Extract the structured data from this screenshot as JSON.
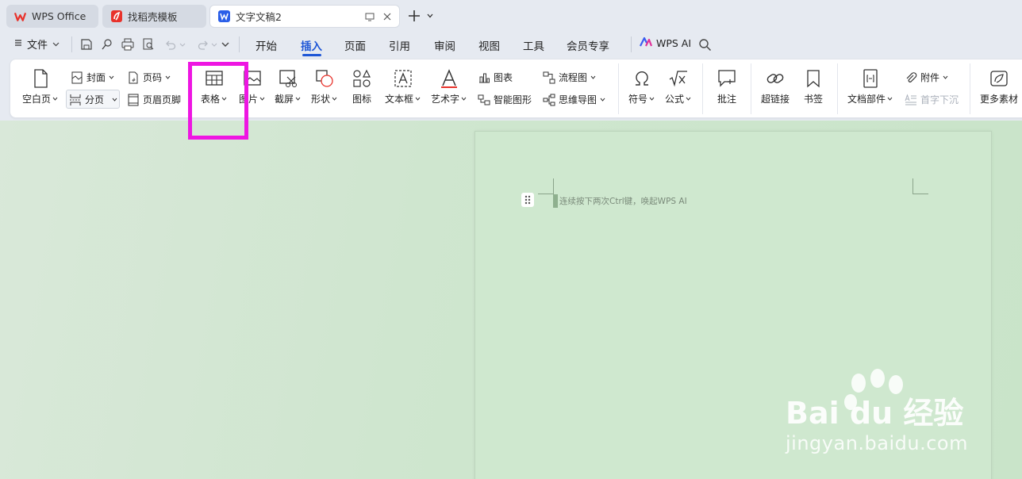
{
  "tabs": [
    {
      "label": "WPS Office",
      "icon": "wps-logo-icon",
      "active": false
    },
    {
      "label": "找稻壳模板",
      "icon": "docer-template-icon",
      "active": false
    },
    {
      "label": "文字文稿2",
      "icon": "word-doc-icon",
      "active": true
    }
  ],
  "menu": {
    "file_label": "文件",
    "tabs": [
      "开始",
      "插入",
      "页面",
      "引用",
      "审阅",
      "视图",
      "工具",
      "会员专享"
    ],
    "active_tab": "插入",
    "wps_ai_label": "WPS AI"
  },
  "ribbon": {
    "blank_page": "空白页",
    "cover": "封面",
    "page_break": "分页",
    "page_number": "页码",
    "header_footer": "页眉页脚",
    "table": "表格",
    "picture": "图片",
    "screenshot": "截屏",
    "shape": "形状",
    "icon": "图标",
    "textbox": "文本框",
    "wordart": "艺术字",
    "chart": "图表",
    "smart_graphic": "智能图形",
    "flowchart": "流程图",
    "mindmap": "思维导图",
    "symbol": "符号",
    "formula": "公式",
    "comment": "批注",
    "hyperlink": "超链接",
    "bookmark": "书签",
    "doc_parts": "文档部件",
    "attachment": "附件",
    "drop_cap": "首字下沉",
    "more_materials": "更多素材"
  },
  "document": {
    "hint": "连续按下两次Ctrl键，唤起WPS AI"
  },
  "watermark": {
    "brand": "Bai du 经验",
    "url": "jingyan.baidu.com"
  },
  "colors": {
    "accent": "#1f57d6",
    "highlight": "#ee16e2",
    "workspace": "#cfe6cf"
  }
}
